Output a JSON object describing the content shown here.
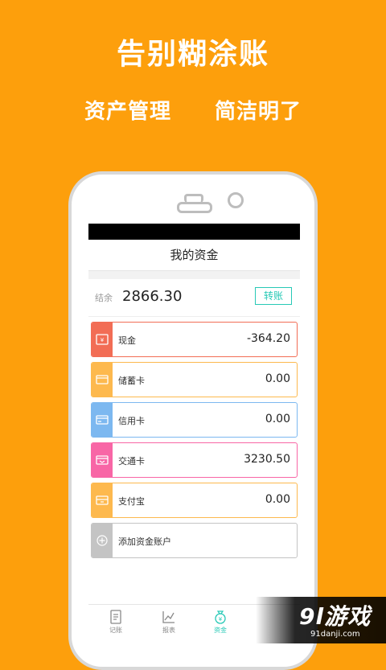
{
  "promo": {
    "headline": "告别糊涂账",
    "tagline_left": "资产管理",
    "tagline_right": "简洁明了"
  },
  "screen": {
    "title": "我的资金",
    "balance_label": "结余",
    "balance_value": "2866.30",
    "transfer_label": "转账",
    "accounts": [
      {
        "name": "现金",
        "amount": "-364.20",
        "color": "#f26d55",
        "icon": "cash-icon"
      },
      {
        "name": "储蓄卡",
        "amount": "0.00",
        "color": "#fdb94e",
        "icon": "card-icon"
      },
      {
        "name": "信用卡",
        "amount": "0.00",
        "color": "#7cb8f0",
        "icon": "card-icon"
      },
      {
        "name": "交通卡",
        "amount": "3230.50",
        "color": "#f866a6",
        "icon": "transit-card-icon"
      },
      {
        "name": "支付宝",
        "amount": "0.00",
        "color": "#fdb94e",
        "icon": "wallet-icon"
      }
    ],
    "add_account_label": "添加资金账户",
    "tabs": [
      {
        "label": "记账",
        "icon": "note-icon"
      },
      {
        "label": "报表",
        "icon": "chart-icon"
      },
      {
        "label": "资金",
        "icon": "money-bag-icon",
        "active": true
      }
    ]
  },
  "watermark": {
    "logo": "9l游戏",
    "url": "91danji.com"
  },
  "colors": {
    "background": "#fd9f0c",
    "accent": "#27c9b6",
    "add_gray": "#c4c4c4"
  }
}
